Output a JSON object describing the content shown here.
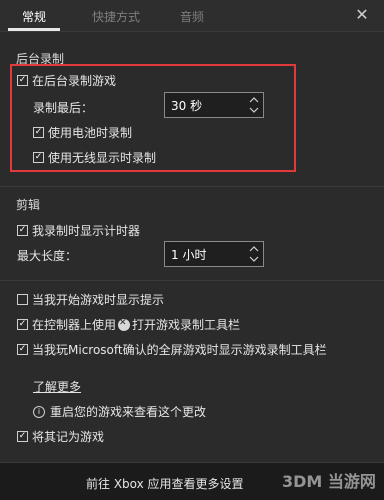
{
  "tabs": [
    {
      "label": "常规"
    },
    {
      "label": "快捷方式"
    },
    {
      "label": "音频"
    }
  ],
  "close_label": "✕",
  "background_recording": {
    "section_title": "后台录制",
    "record_in_background": "在后台录制游戏",
    "record_last_label": "录制最后：",
    "record_last_value": "30 秒",
    "use_battery": "使用电池时录制",
    "use_wireless_display": "使用无线显示时录制"
  },
  "clips": {
    "section_title": "剪辑",
    "show_timer": "我录制时显示计时器",
    "max_length_label": "最大长度：",
    "max_length_value": "1 小时"
  },
  "options": {
    "show_tips": "当我开始游戏时显示提示",
    "open_toolbar_controller_prefix": "在控制器上使用",
    "open_toolbar_controller_suffix": "打开游戏录制工具栏",
    "show_toolbar_fullscreen": "当我玩Microsoft确认的全屏游戏时显示游戏录制工具栏"
  },
  "learn_more": "了解更多",
  "restart_notice": "重启您的游戏来查看这个更改",
  "remember_as_game": "将其记为游戏",
  "bottom_bar": {
    "text": "前往 Xbox 应用查看更多设置"
  },
  "watermark": "3DM 当游网",
  "colors": {
    "highlight_border": "#e23a3a",
    "background": "#2b2b2b"
  }
}
